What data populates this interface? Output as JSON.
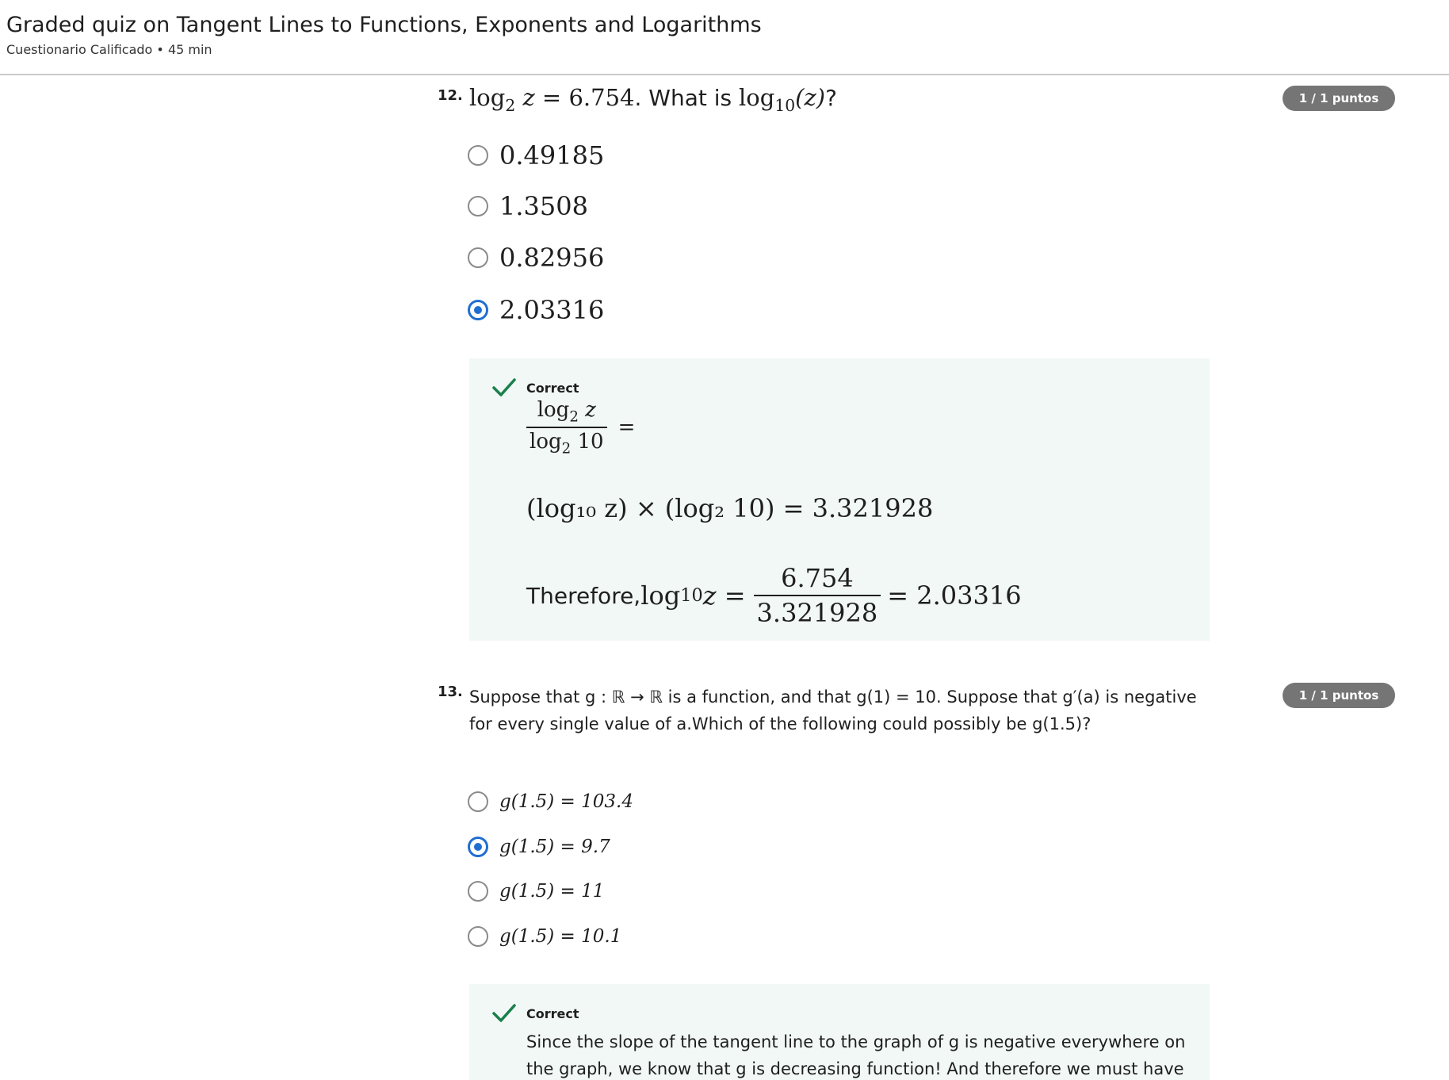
{
  "header": {
    "title": "Graded quiz on Tangent Lines to Functions, Exponents and Logarithms",
    "subtitle": "Cuestionario Calificado • 45 min"
  },
  "q12": {
    "number": "12.",
    "badge": "1 / 1 puntos",
    "question": {
      "lhs": "log",
      "base2": "2",
      "var": "z",
      "eq": " = 6.754",
      "text": ". What is ",
      "log10": "log",
      "base10": "10",
      "arg": "(z)",
      "end": "?"
    },
    "options": [
      {
        "label": "0.49185",
        "selected": false
      },
      {
        "label": "1.3508",
        "selected": false
      },
      {
        "label": "0.82956",
        "selected": false
      },
      {
        "label": "2.03316",
        "selected": true
      }
    ],
    "feedback": {
      "status": "Correct",
      "frac_num": "log",
      "frac_num_base": "2",
      "frac_num_var": " z",
      "frac_den": "log",
      "frac_den_base": "2",
      "frac_den_val": " 10",
      "frac_eq": "=",
      "line2": "(log₁₀ z) × (log₂ 10) = 3.321928",
      "line3_text": "Therefore, ",
      "line3_log": "log",
      "line3_base": "10",
      "line3_var": " z = ",
      "line3_num": "6.754",
      "line3_den": "3.321928",
      "line3_result": " = 2.03316"
    }
  },
  "q13": {
    "number": "13.",
    "badge": "1 / 1 puntos",
    "question": "Suppose that g : ℝ → ℝ is a function, and that g(1) = 10. Suppose that g′(a) is negative for every single value of a.Which of the following could possibly be g(1.5)?",
    "options": [
      {
        "label": "g(1.5) = 103.4",
        "selected": false
      },
      {
        "label": "g(1.5) = 9.7",
        "selected": true
      },
      {
        "label": "g(1.5) = 11",
        "selected": false
      },
      {
        "label": "g(1.5) = 10.1",
        "selected": false
      }
    ],
    "feedback": {
      "status": "Correct",
      "text": "Since the slope of the tangent line to the graph of g is negative everywhere on the graph, we know that g is decreasing function! And therefore we must have"
    }
  },
  "colors": {
    "accent": "#1f6fd1",
    "badge": "#757575",
    "feedback_bg": "#f1f8f5",
    "check": "#1a7f4b"
  }
}
